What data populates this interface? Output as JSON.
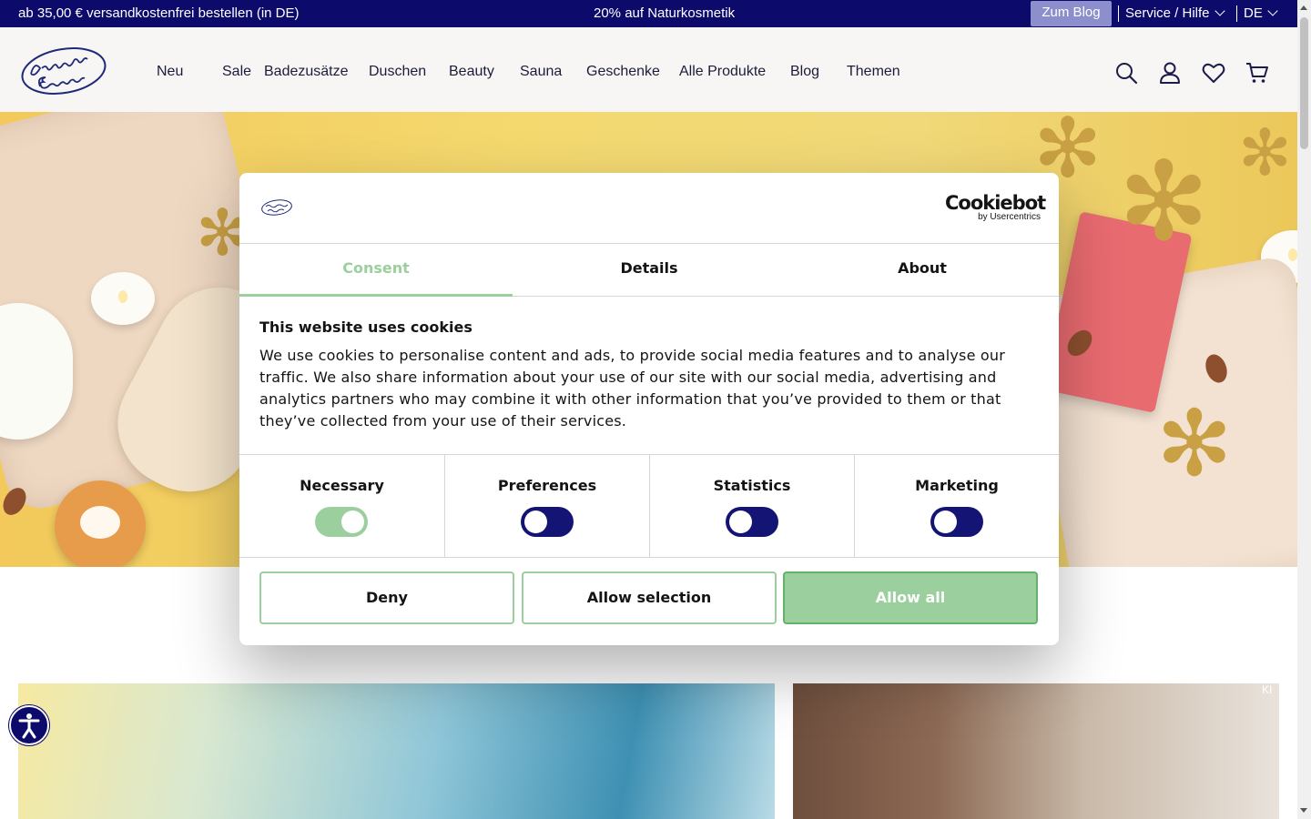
{
  "topbar": {
    "promo_left": "ab 35,00 € versandkostenfrei bestellen (in DE)",
    "promo_center": "20% auf Naturkosmetik",
    "blog_button": "Zum Blog",
    "service_menu": "Service / Hilfe",
    "language": "DE"
  },
  "header": {
    "logo_icon": "dresdner-essenz-logo",
    "nav": [
      "Neu",
      "Sale",
      "Badezusätze",
      "Duschen",
      "Beauty",
      "Sauna",
      "Geschenke",
      "Alle Produkte",
      "Blog",
      "Themen"
    ],
    "icons": [
      "search-icon",
      "account-icon",
      "wishlist-heart-icon",
      "cart-icon"
    ]
  },
  "hero": {
    "description_icon": "hero-image-wellness-products"
  },
  "cards": {
    "ki_badge": "KI"
  },
  "accessibility": {
    "icon": "accessibility-icon"
  },
  "cookie_dialog": {
    "brand": "Cookiebot",
    "brand_sub": "by Usercentrics",
    "tabs": [
      "Consent",
      "Details",
      "About"
    ],
    "active_tab": "Consent",
    "title": "This website uses cookies",
    "body": "We use cookies to personalise content and ads, to provide social media features and to analyse our traffic. We also share information about your use of our site with our social media, advertising and analytics partners who may combine it with other information that you’ve provided to them or that they’ve collected from your use of their services.",
    "toggles": [
      {
        "label": "Necessary",
        "checked": true
      },
      {
        "label": "Preferences",
        "checked": false
      },
      {
        "label": "Statistics",
        "checked": false
      },
      {
        "label": "Marketing",
        "checked": false
      }
    ],
    "buttons": {
      "deny": "Deny",
      "allow_selection": "Allow selection",
      "allow_all": "Allow all"
    }
  },
  "colors": {
    "navy": "#0c0a6b",
    "accent_green": "#9bcf9d",
    "blog_button_bg": "#8d8fcc"
  }
}
